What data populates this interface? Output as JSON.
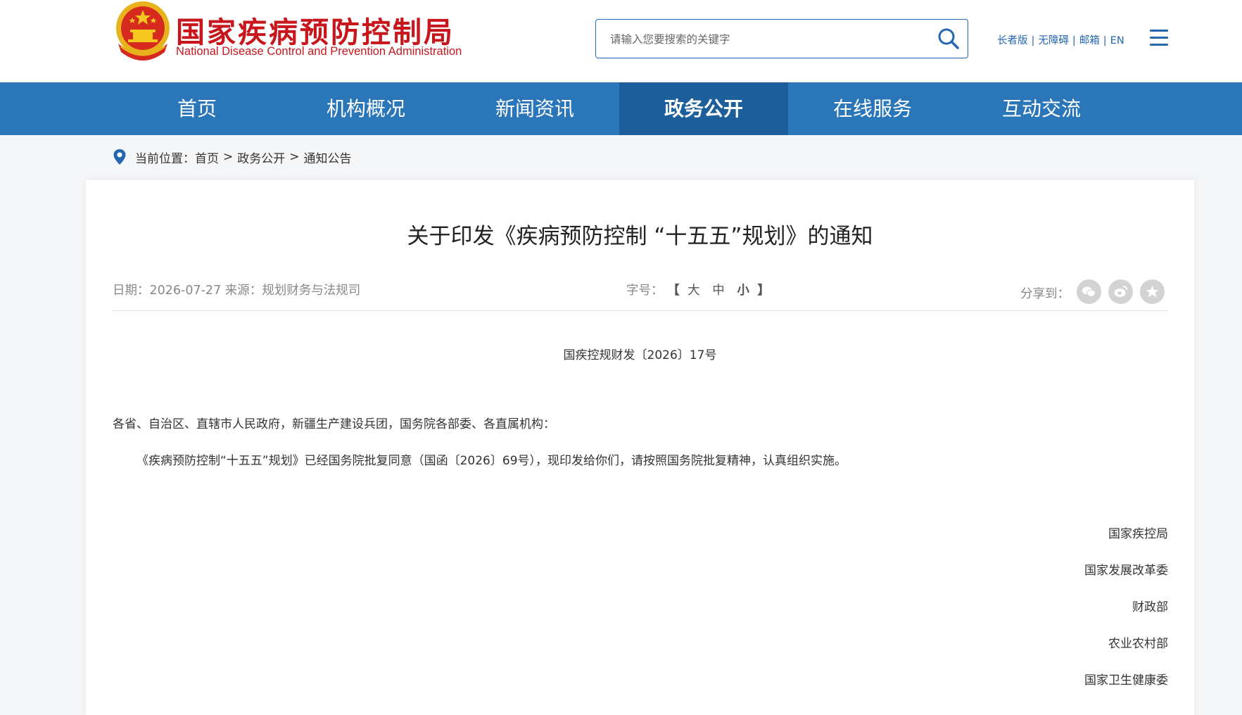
{
  "header": {
    "logo_cn": "国家疾病预防控制局",
    "logo_en": "National Disease Control and Prevention Administration",
    "search_placeholder": "请输入您要搜索的关键字",
    "links": [
      "长者版",
      "无障碍",
      "邮箱",
      "EN"
    ],
    "separator": "|"
  },
  "nav": {
    "items": [
      "首页",
      "机构概况",
      "新闻资讯",
      "政务公开",
      "在线服务",
      "互动交流"
    ],
    "active": "政务公开"
  },
  "breadcrumb": {
    "prefix": "当前位置：",
    "items": [
      "首页",
      "政务公开",
      "通知公告"
    ],
    "arrow": ">"
  },
  "article": {
    "title": "关于印发《疾病预防控制 “十五五”规划》的通知",
    "date_label": "日期：",
    "date": "2026-07-27",
    "source_label": "来源：",
    "source": "规划财务与法规司",
    "fontsize_label": "字号：",
    "bracket_open": "【",
    "bracket_close": "】",
    "sizes": [
      "大",
      "中",
      "小"
    ],
    "share_label": "分享到：",
    "share_icons": [
      "wechat-icon",
      "weibo-icon",
      "favorite-icon"
    ],
    "doc_number": "国疾控规财发〔2026〕17号",
    "salutation": "各省、自治区、直辖市人民政府，新疆生产建设兵团，国务院各部委、各直属机构：",
    "body": "《疾病预防控制“十五五”规划》已经国务院批复同意（国函〔2026〕69号），现印发给你们，请按照国务院批复精神，认真组织实施。",
    "signatories": [
      "国家疾控局",
      "国家发展改革委",
      "财政部",
      "农业农村部",
      "国家卫生健康委"
    ]
  },
  "colors": {
    "brand_red": "#c8161d",
    "nav_blue": "#2a76b9",
    "nav_active": "#1d5f9a",
    "link_blue": "#2467b1"
  }
}
